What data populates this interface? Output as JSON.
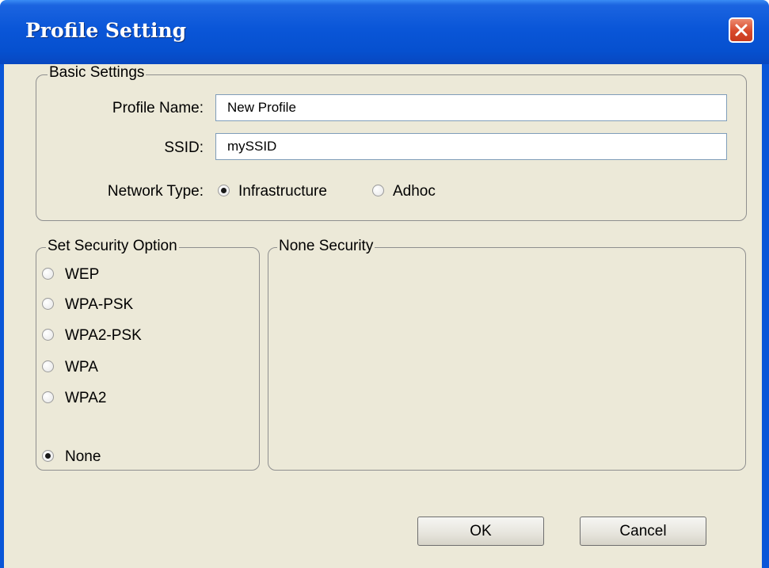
{
  "window": {
    "title": "Profile Setting"
  },
  "basic_settings": {
    "legend": "Basic Settings",
    "profile_name_label": "Profile Name:",
    "profile_name_value": "New Profile",
    "ssid_label": "SSID:",
    "ssid_value": "mySSID",
    "network_type_label": "Network Type:",
    "network_type_options": [
      {
        "label": "Infrastructure",
        "selected": true
      },
      {
        "label": "Adhoc",
        "selected": false
      }
    ]
  },
  "security_option": {
    "legend": "Set Security Option",
    "options": [
      {
        "label": "WEP",
        "selected": false
      },
      {
        "label": "WPA-PSK",
        "selected": false
      },
      {
        "label": "WPA2-PSK",
        "selected": false
      },
      {
        "label": "WPA",
        "selected": false
      },
      {
        "label": "WPA2",
        "selected": false
      },
      {
        "label": "None",
        "selected": true
      }
    ]
  },
  "security_detail": {
    "legend": "None Security"
  },
  "buttons": {
    "ok": "OK",
    "cancel": "Cancel"
  }
}
